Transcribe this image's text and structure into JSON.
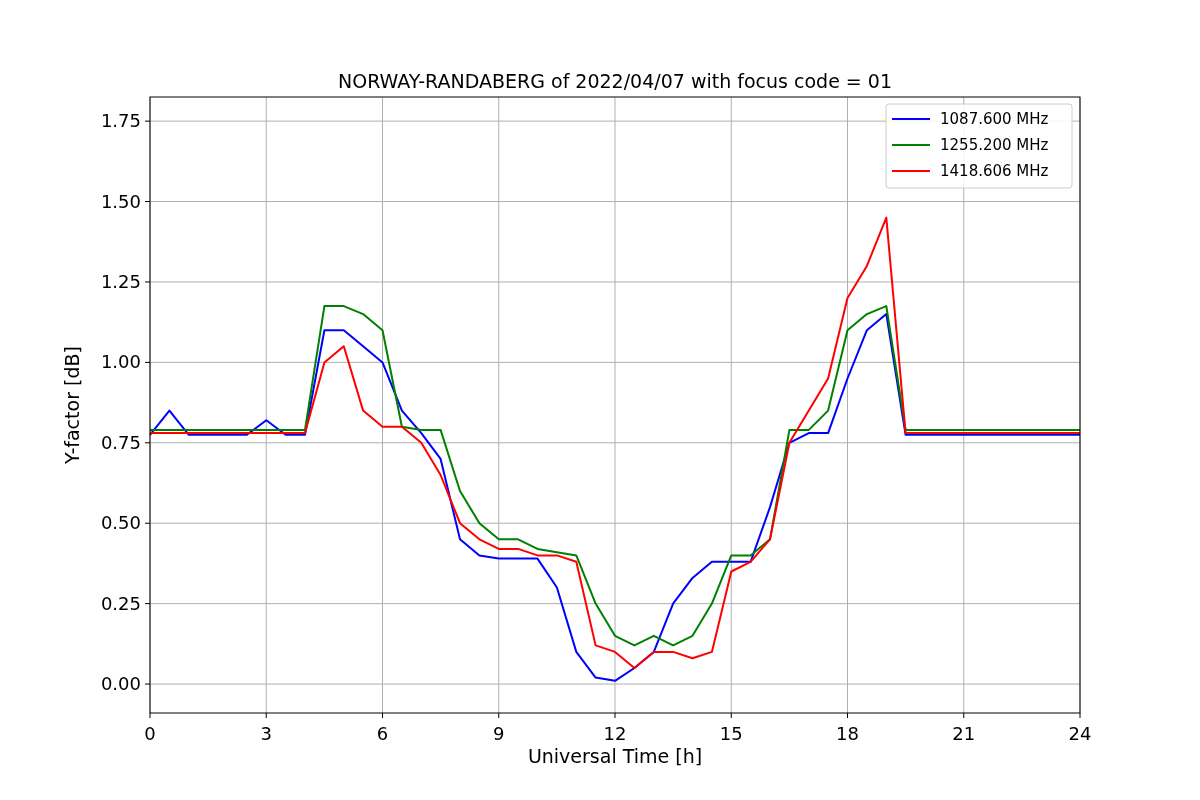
{
  "figure": {
    "chart_data": {
      "type": "line",
      "title": "NORWAY-RANDABERG of 2022/04/07 with focus code = 01",
      "xlabel": "Universal Time [h]",
      "ylabel": "Y-factor [dB]",
      "x": [
        0,
        0.5,
        1,
        1.5,
        2,
        2.5,
        3,
        3.5,
        4,
        4.5,
        5,
        5.5,
        6,
        6.5,
        7,
        7.5,
        8,
        8.5,
        9,
        9.5,
        10,
        10.5,
        11,
        11.5,
        12,
        12.5,
        13,
        13.5,
        14,
        14.5,
        15,
        15.5,
        16,
        16.5,
        17,
        17.5,
        18,
        18.5,
        19,
        19.5,
        20,
        20.5,
        21,
        21.5,
        22,
        22.5,
        23,
        23.5,
        24
      ],
      "series": [
        {
          "name": "1087.600 MHz",
          "color": "#0000ff",
          "values": [
            0.775,
            0.85,
            0.775,
            0.775,
            0.775,
            0.775,
            0.82,
            0.775,
            0.775,
            1.1,
            1.1,
            1.05,
            1.0,
            0.85,
            0.78,
            0.7,
            0.45,
            0.4,
            0.39,
            0.39,
            0.39,
            0.3,
            0.1,
            0.02,
            0.01,
            0.05,
            0.1,
            0.25,
            0.33,
            0.38,
            0.38,
            0.38,
            0.55,
            0.75,
            0.78,
            0.78,
            0.95,
            1.1,
            1.15,
            0.775,
            0.775,
            0.775,
            0.775,
            0.775,
            0.775,
            0.775,
            0.775,
            0.775,
            0.775
          ]
        },
        {
          "name": "1255.200 MHz",
          "color": "#008000",
          "values": [
            0.79,
            0.79,
            0.79,
            0.79,
            0.79,
            0.79,
            0.79,
            0.79,
            0.79,
            1.175,
            1.175,
            1.15,
            1.1,
            0.8,
            0.79,
            0.79,
            0.6,
            0.5,
            0.45,
            0.45,
            0.42,
            0.41,
            0.4,
            0.25,
            0.15,
            0.12,
            0.15,
            0.12,
            0.15,
            0.25,
            0.4,
            0.4,
            0.45,
            0.79,
            0.79,
            0.85,
            1.1,
            1.15,
            1.175,
            0.79,
            0.79,
            0.79,
            0.79,
            0.79,
            0.79,
            0.79,
            0.79,
            0.79,
            0.79
          ]
        },
        {
          "name": "1418.606 MHz",
          "color": "#ff0000",
          "values": [
            0.78,
            0.78,
            0.78,
            0.78,
            0.78,
            0.78,
            0.78,
            0.78,
            0.78,
            1.0,
            1.05,
            0.85,
            0.8,
            0.8,
            0.75,
            0.65,
            0.5,
            0.45,
            0.42,
            0.42,
            0.4,
            0.4,
            0.38,
            0.12,
            0.1,
            0.05,
            0.1,
            0.1,
            0.08,
            0.1,
            0.35,
            0.38,
            0.45,
            0.75,
            0.85,
            0.95,
            1.2,
            1.3,
            1.45,
            0.78,
            0.78,
            0.78,
            0.78,
            0.78,
            0.78,
            0.78,
            0.78,
            0.78,
            0.78
          ]
        }
      ],
      "grid": true,
      "legend": true,
      "xlim": [
        0,
        24
      ],
      "ylim": [
        -0.09,
        1.825
      ],
      "xticks": [
        0,
        3,
        6,
        9,
        12,
        15,
        18,
        21,
        24
      ],
      "yticks": [
        {
          "value": 0,
          "label": "0.00"
        },
        {
          "value": 0.25,
          "label": "0.25"
        },
        {
          "value": 0.5,
          "label": "0.50"
        },
        {
          "value": 0.75,
          "label": "0.75"
        },
        {
          "value": 1,
          "label": "1.00"
        },
        {
          "value": 1.25,
          "label": "1.25"
        },
        {
          "value": 1.5,
          "label": "1.50"
        },
        {
          "value": 1.75,
          "label": "1.75"
        }
      ]
    }
  }
}
